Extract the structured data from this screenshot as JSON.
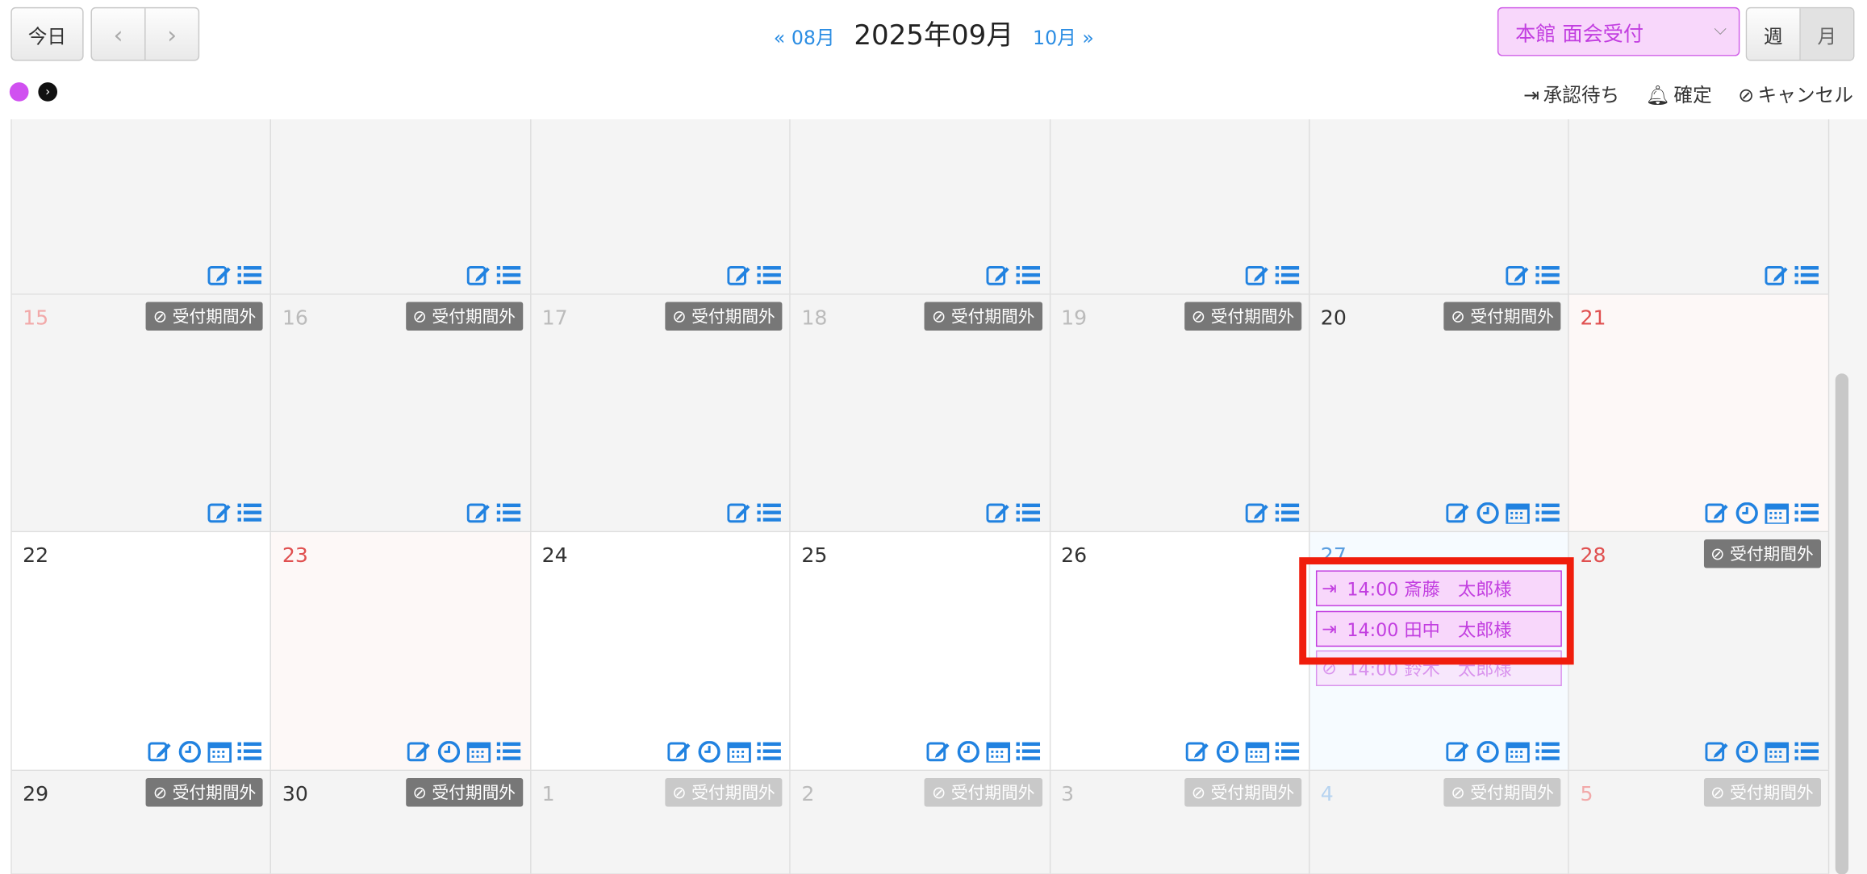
{
  "toolbar": {
    "today_label": "今日",
    "prev_icon": "‹",
    "next_icon": "›",
    "prev_month_label": "« 08月",
    "current_month_label": "2025年09月",
    "next_month_label": "10月 »",
    "location_select": "本館 面会受付",
    "view_week": "週",
    "view_month": "月"
  },
  "legend": {
    "waiting": "承認待ち",
    "confirmed": "確定",
    "cancel": "キャンセル"
  },
  "colors": {
    "accent": "#2182e0",
    "event": "#c23ee0",
    "highlight": "#f01d0c"
  },
  "weeks": [
    {
      "days": [
        {
          "num": "",
          "badge": ""
        },
        {
          "num": "",
          "badge": ""
        },
        {
          "num": "",
          "badge": ""
        },
        {
          "num": "",
          "badge": ""
        },
        {
          "num": "",
          "badge": ""
        },
        {
          "num": "",
          "badge": ""
        },
        {
          "num": "",
          "badge": ""
        }
      ]
    },
    {
      "days": [
        {
          "num": "15",
          "badge": "⊘ 受付期間外"
        },
        {
          "num": "16",
          "badge": "⊘ 受付期間外"
        },
        {
          "num": "17",
          "badge": "⊘ 受付期間外"
        },
        {
          "num": "18",
          "badge": "⊘ 受付期間外"
        },
        {
          "num": "19",
          "badge": "⊘ 受付期間外"
        },
        {
          "num": "20",
          "badge": "⊘ 受付期間外"
        },
        {
          "num": "21",
          "badge": ""
        }
      ]
    },
    {
      "days": [
        {
          "num": "22",
          "badge": ""
        },
        {
          "num": "23",
          "badge": ""
        },
        {
          "num": "24",
          "badge": ""
        },
        {
          "num": "25",
          "badge": ""
        },
        {
          "num": "26",
          "badge": ""
        },
        {
          "num": "27",
          "badge": ""
        },
        {
          "num": "28",
          "badge": "⊘ 受付期間外"
        }
      ]
    },
    {
      "days": [
        {
          "num": "29",
          "badge": "⊘ 受付期間外"
        },
        {
          "num": "30",
          "badge": "⊘ 受付期間外"
        },
        {
          "num": "1",
          "badge": "⊘ 受付期間外"
        },
        {
          "num": "2",
          "badge": "⊘ 受付期間外"
        },
        {
          "num": "3",
          "badge": "⊘ 受付期間外"
        },
        {
          "num": "4",
          "badge": "⊘ 受付期間外"
        },
        {
          "num": "5",
          "badge": "⊘ 受付期間外"
        }
      ]
    }
  ],
  "events": [
    {
      "label": "14:00 斎藤　太郎様",
      "status": "waiting"
    },
    {
      "label": "14:00 田中　太郎様",
      "status": "waiting"
    },
    {
      "label": "14:00 鈴木　太郎様",
      "status": "cancel"
    }
  ]
}
